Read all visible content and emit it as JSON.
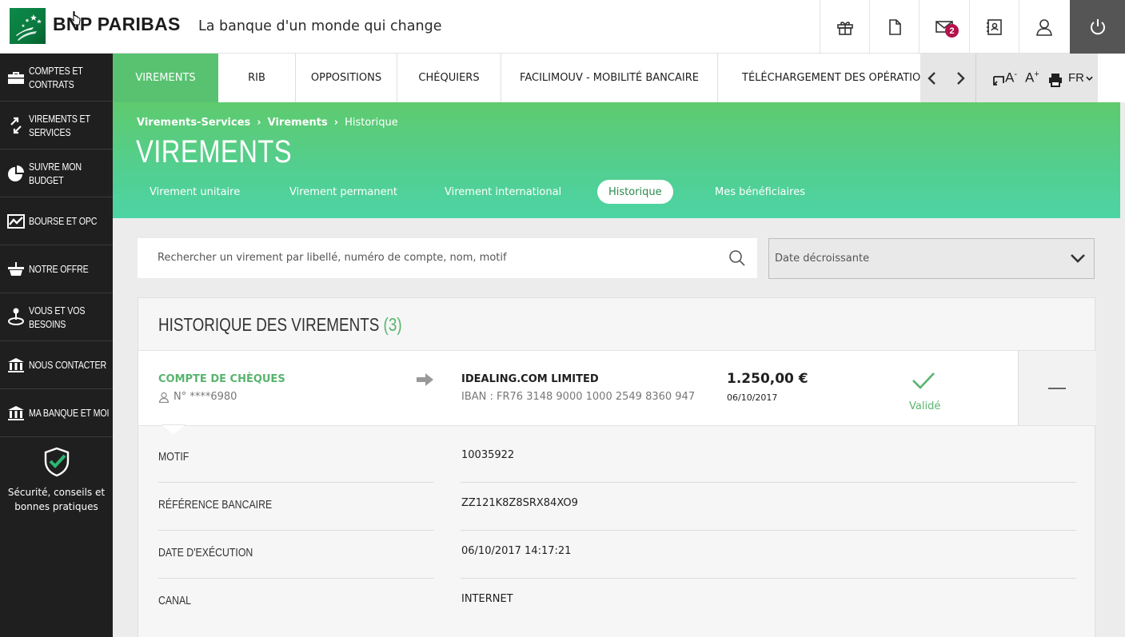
{
  "header": {
    "brand": "BNP PARIBAS",
    "tagline": "La banque d'un monde qui change",
    "messages_count": "2",
    "icons": [
      "gift-icon",
      "document-icon",
      "mail-icon",
      "contact-card-icon",
      "user-icon",
      "power-icon"
    ]
  },
  "sidebar": {
    "items": [
      {
        "label1": "COMPTES ET",
        "label2": "CONTRATS",
        "icon": "briefcase-icon"
      },
      {
        "label1": "VIREMENTS ET",
        "label2": "SERVICES",
        "icon": "transfer-arrows-icon"
      },
      {
        "label1": "SUIVRE MON",
        "label2": "BUDGET",
        "icon": "pie-chart-icon"
      },
      {
        "label1": "BOURSE ET OPC",
        "label2": "",
        "icon": "stock-chart-icon"
      },
      {
        "label1": "NOTRE OFFRE",
        "label2": "",
        "icon": "basket-icon"
      },
      {
        "label1": "VOUS ET VOS",
        "label2": "BESOINS",
        "icon": "person-target-icon"
      },
      {
        "label1": "NOUS CONTACTER",
        "label2": "",
        "icon": "bank-icon"
      },
      {
        "label1": "MA BANQUE ET MOI",
        "label2": "",
        "icon": "bank-icon"
      }
    ],
    "security_line1": "Sécurité, conseils et",
    "security_line2": "bonnes pratiques"
  },
  "tabs": [
    {
      "label": "VIREMENTS",
      "active": true
    },
    {
      "label": "RIB"
    },
    {
      "label": "OPPOSITIONS"
    },
    {
      "label": "CHÉQUIERS"
    },
    {
      "label": "FACILIMOUV - MOBILITÉ BANCAIRE"
    },
    {
      "label": "TÉLÉCHARGEMENT DES OPÉRATIONS"
    }
  ],
  "tools": {
    "font_decrease": "A",
    "font_increase": "A",
    "language": "FR"
  },
  "banner": {
    "breadcrumb": [
      "Virements-Services",
      "Virements",
      "Historique"
    ],
    "title": "VIREMENTS",
    "subtabs": [
      {
        "label": "Virement unitaire"
      },
      {
        "label": "Virement permanent"
      },
      {
        "label": "Virement international"
      },
      {
        "label": "Historique",
        "active": true
      },
      {
        "label": "Mes bénéficiaires"
      }
    ]
  },
  "search": {
    "placeholder": "Rechercher un virement par libellé, numéro de compte, nom, motif",
    "sort_value": "Date décroissante"
  },
  "history": {
    "title": "HISTORIQUE DES VIREMENTS",
    "count": "(3)",
    "transfer": {
      "account_name": "COMPTE DE CHÈQUES",
      "account_number": "N° ****6980",
      "beneficiary": "IDEALING.COM LIMITED",
      "iban": "IBAN : FR76 3148 9000 1000 2549 8360 947",
      "amount": "1.250,00 €",
      "date": "06/10/2017",
      "status": "Validé"
    },
    "details": [
      {
        "label": "MOTIF",
        "value": "10035922"
      },
      {
        "label": "RÉFÉRENCE BANCAIRE",
        "value": "ZZ121K8Z8SRX84XO9"
      },
      {
        "label": "DATE D'EXÉCUTION",
        "value": "06/10/2017 14:17:21"
      },
      {
        "label": "CANAL",
        "value": "INTERNET"
      }
    ]
  },
  "colors": {
    "green": "#58c271",
    "green_text": "#58b46e",
    "sidebar": "#1f1f1f",
    "badge": "#b3124b"
  }
}
